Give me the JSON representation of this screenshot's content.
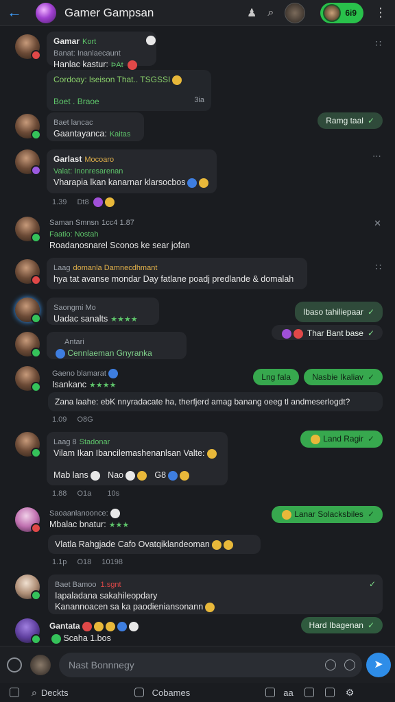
{
  "header": {
    "title": "Gamer Gampsan",
    "pill_label": "6i9"
  },
  "messages": [
    {
      "name": "Gamar",
      "tag": "Kort",
      "sub": "Banat: Inanlaecaunt",
      "line": "Hanlac kastur:",
      "line_tag": "ÞAt",
      "highlight": "Cordoay: lseison That.. TSGSSI",
      "sub2": "Boet . Braoe",
      "sub2_meta": "3ia"
    },
    {
      "name": "Baet lancac",
      "line": "Gaantayanca:",
      "line_tag": "Kaitas"
    },
    {
      "name": "Garlast",
      "tag": "Mocoaro",
      "sub": "Valat: Inonresarenan",
      "line": "Vharapia lkan kanarnar klarsocbos",
      "meta": "1.39",
      "meta2": "Dt8"
    },
    {
      "name": "Saman Smnsn",
      "tag": "1cc4 1.87",
      "sub": "Faatio: Nostah",
      "line": "Roadanosnarel Sconos ke sear jofan"
    },
    {
      "name": "Laag",
      "tag": "domanla Damnecdhmant",
      "line": "hya tat avanse mondar Day fatlane poadj predlande & domalah"
    },
    {
      "name": "Saongmi Mo",
      "line": "Uadac sanalts"
    },
    {
      "name": "Antari",
      "line": "Cennlaeman Gnyranka"
    },
    {
      "name": "Gaeno blamarat",
      "line": "Isankanc",
      "wide": "Zana laahe: ebK nnyradacate ha, therfjerd amag banang oeeg tl andmeserlogdt?",
      "meta": "1.09",
      "meta2": "O8G"
    },
    {
      "name": "Laag 8",
      "tag": "Stadonar",
      "line": "Vilam Ikan Ibancilemashenanlsan Valte:",
      "icons_line": "Mab lans",
      "icons_2": "Nao",
      "icons_3": "G8",
      "meta": "1.88",
      "meta2": "O1a",
      "meta3": "10s"
    },
    {
      "name": "Saoaanlanoonce:",
      "line": "Mbalac bnatur:",
      "wide": "Vlatla Rahgjade Cafo Ovatqiklandeoman",
      "meta": "1.1p",
      "meta2": "O18",
      "meta3": "10198"
    },
    {
      "name": "Baet Bamoo",
      "tag": "1.sgnt",
      "line": "Iapaladana sakahileopdary",
      "line2": "Kanannoacen sa ka paodieniansonann"
    },
    {
      "name": "Gantata",
      "line": "Scaha 1.bos"
    }
  ],
  "outgoing": [
    {
      "text": "Ramg taal"
    },
    {
      "text": "Ibaso tahiliepaar"
    },
    {
      "text": "Thar Bant base"
    },
    {
      "text": "Lng fala"
    },
    {
      "text": "Nasbie Ikaliav"
    },
    {
      "text": "Land Ragir"
    },
    {
      "text": "Lanar Solacksbiles"
    },
    {
      "text": "Hard Ibagenan"
    }
  ],
  "composer": {
    "placeholder": "Nast Bonnnegy"
  },
  "bottombar": {
    "deckts": "Deckts",
    "cobames": "Cobames",
    "right_label": "aa"
  }
}
